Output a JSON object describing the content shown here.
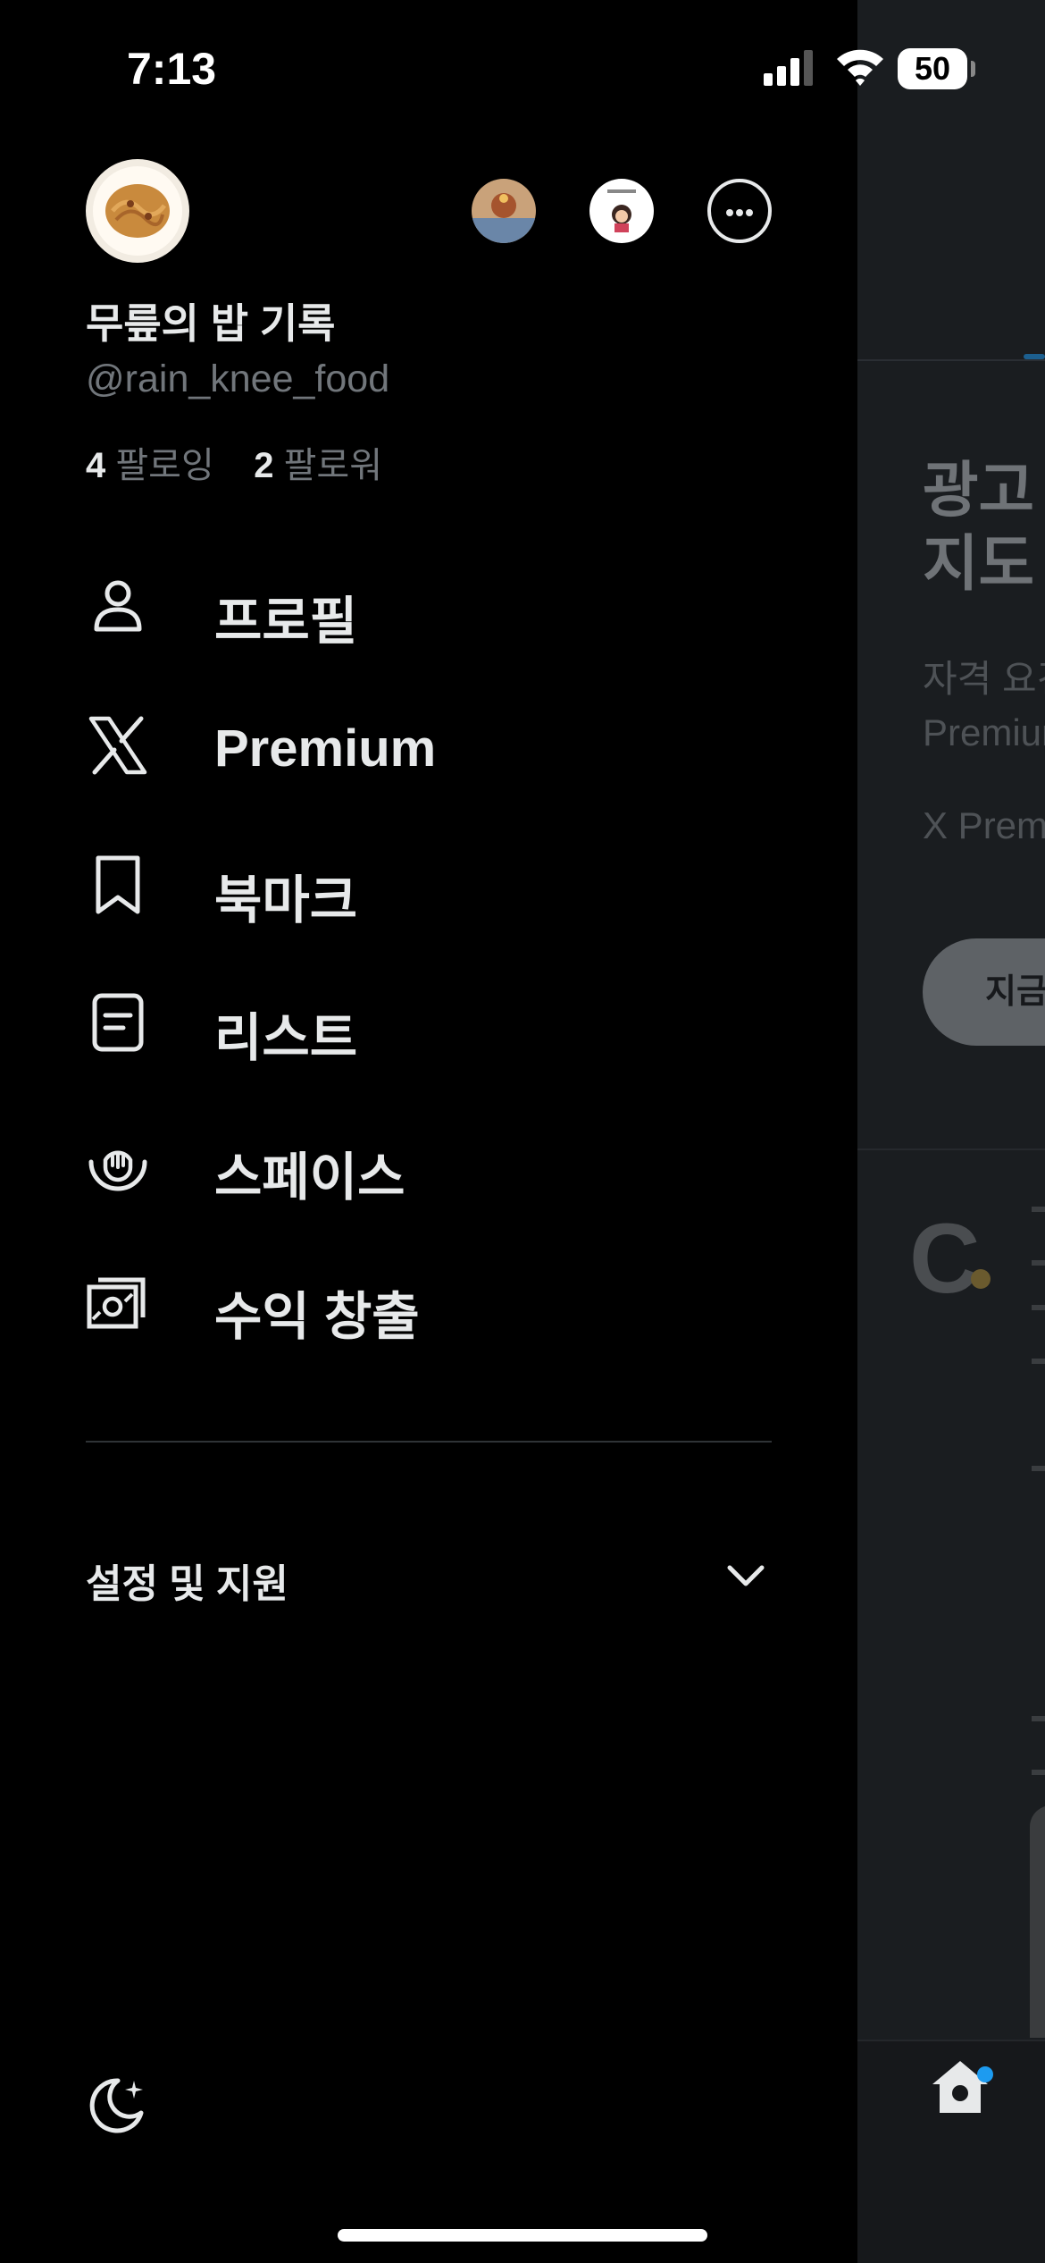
{
  "status_bar": {
    "time": "7:13",
    "battery": "50"
  },
  "account": {
    "display_name": "무릎의 밥 기록",
    "handle": "@rain_knee_food",
    "following_count": "4",
    "following_label": "팔로잉",
    "followers_count": "2",
    "followers_label": "팔로워"
  },
  "menu": {
    "items": [
      {
        "label": "프로필",
        "icon": "person-icon"
      },
      {
        "label": "Premium",
        "icon": "x-logo-icon"
      },
      {
        "label": "북마크",
        "icon": "bookmark-icon"
      },
      {
        "label": "리스트",
        "icon": "list-icon"
      },
      {
        "label": "스페이스",
        "icon": "spaces-icon"
      },
      {
        "label": "수익 창출",
        "icon": "monetization-icon"
      }
    ]
  },
  "settings": {
    "label": "설정 및 지원"
  },
  "background_feed": {
    "ad_title": "광고\n지도",
    "ad_body": "자격 요건\nPremium",
    "ad_sub": "X Prem",
    "ad_button": "지금"
  },
  "colors": {
    "accent": "#1d9bf0",
    "text": "#e7e9ea",
    "muted": "#71767b"
  }
}
